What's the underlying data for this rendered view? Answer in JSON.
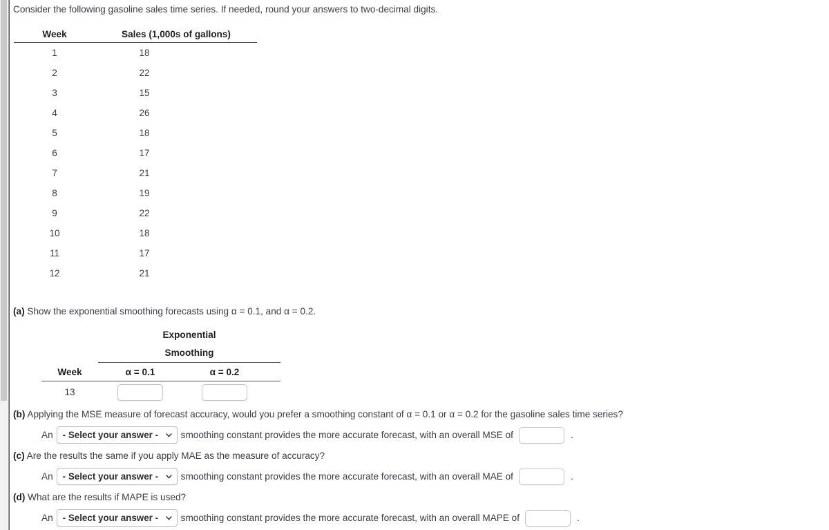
{
  "intro": "Consider the following gasoline sales time series. If needed, round your answers to two-decimal digits.",
  "data_table": {
    "headers": {
      "week": "Week",
      "sales": "Sales (1,000s of gallons)"
    },
    "rows": [
      {
        "week": "1",
        "sales": "18"
      },
      {
        "week": "2",
        "sales": "22"
      },
      {
        "week": "3",
        "sales": "15"
      },
      {
        "week": "4",
        "sales": "26"
      },
      {
        "week": "5",
        "sales": "18"
      },
      {
        "week": "6",
        "sales": "17"
      },
      {
        "week": "7",
        "sales": "21"
      },
      {
        "week": "8",
        "sales": "19"
      },
      {
        "week": "9",
        "sales": "22"
      },
      {
        "week": "10",
        "sales": "18"
      },
      {
        "week": "11",
        "sales": "17"
      },
      {
        "week": "12",
        "sales": "21"
      }
    ]
  },
  "part_a": {
    "marker": "(a)",
    "prompt": "Show the exponential smoothing forecasts using α = 0.1, and α = 0.2.",
    "table": {
      "spanner_line1": "Exponential",
      "spanner_line2": "Smoothing",
      "header_week": "Week",
      "header_alpha1": "α = 0.1",
      "header_alpha2": "α = 0.2",
      "row_week": "13",
      "input_alpha1_value": "",
      "input_alpha2_value": ""
    }
  },
  "part_b": {
    "marker": "(b)",
    "prompt": "Applying the MSE measure of forecast accuracy, would you prefer a smoothing constant of α = 0.1 or α = 0.2 for the gasoline sales time series?",
    "answer_prefix": "An",
    "select_value": "- Select your answer -",
    "select_options": [
      "- Select your answer -"
    ],
    "answer_mid": "smoothing constant provides the more accurate forecast, with an overall MSE of",
    "input_value": "",
    "answer_suffix": "."
  },
  "part_c": {
    "marker": "(c)",
    "prompt": "Are the results the same if you apply MAE as the measure of accuracy?",
    "answer_prefix": "An",
    "select_value": "- Select your answer -",
    "select_options": [
      "- Select your answer -"
    ],
    "answer_mid": "smoothing constant provides the more accurate forecast, with an overall MAE of",
    "input_value": "",
    "answer_suffix": "."
  },
  "part_d": {
    "marker": "(d)",
    "prompt": "What are the results if MAPE is used?",
    "answer_prefix": "An",
    "select_value": "- Select your answer -",
    "select_options": [
      "- Select your answer -"
    ],
    "answer_mid": "smoothing constant provides the more accurate forecast, with an overall MAPE of",
    "input_value": "",
    "answer_suffix": "."
  },
  "colors": {
    "text": "#3b3b43",
    "heading": "#1f1f22",
    "rule": "#4d4d4d",
    "input_border": "#c6c6c6",
    "background": "#ffffff"
  }
}
